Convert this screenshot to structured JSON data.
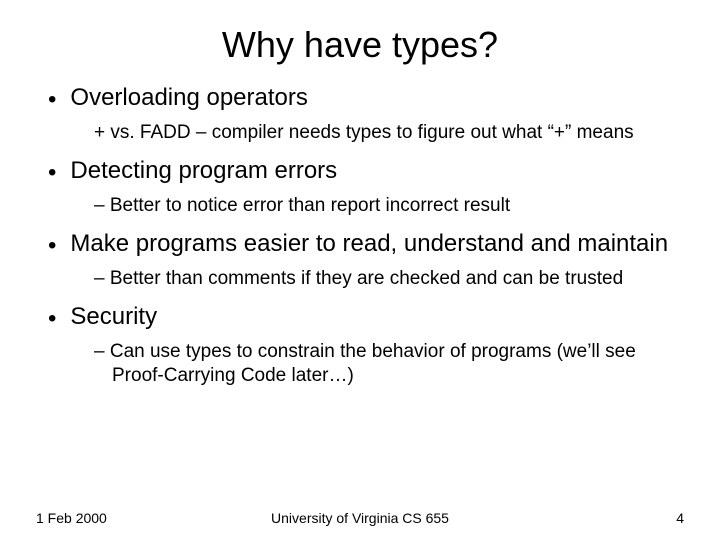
{
  "title": "Why have types?",
  "bullets": [
    {
      "text": "Overloading operators",
      "sub": "+ vs. FADD – compiler needs types to figure out what “+” means",
      "dash": false
    },
    {
      "text": "Detecting program errors",
      "sub": "Better to notice error than report incorrect result",
      "dash": true
    },
    {
      "text": "Make programs easier to read, understand and maintain",
      "sub": "Better than comments if they are checked and can be trusted",
      "dash": true
    },
    {
      "text": "Security",
      "sub": "Can use types to constrain the behavior of programs (we’ll see Proof-Carrying Code later…)",
      "dash": true
    }
  ],
  "footer": {
    "date": "1 Feb 2000",
    "center": "University of Virginia CS 655",
    "page": "4"
  }
}
